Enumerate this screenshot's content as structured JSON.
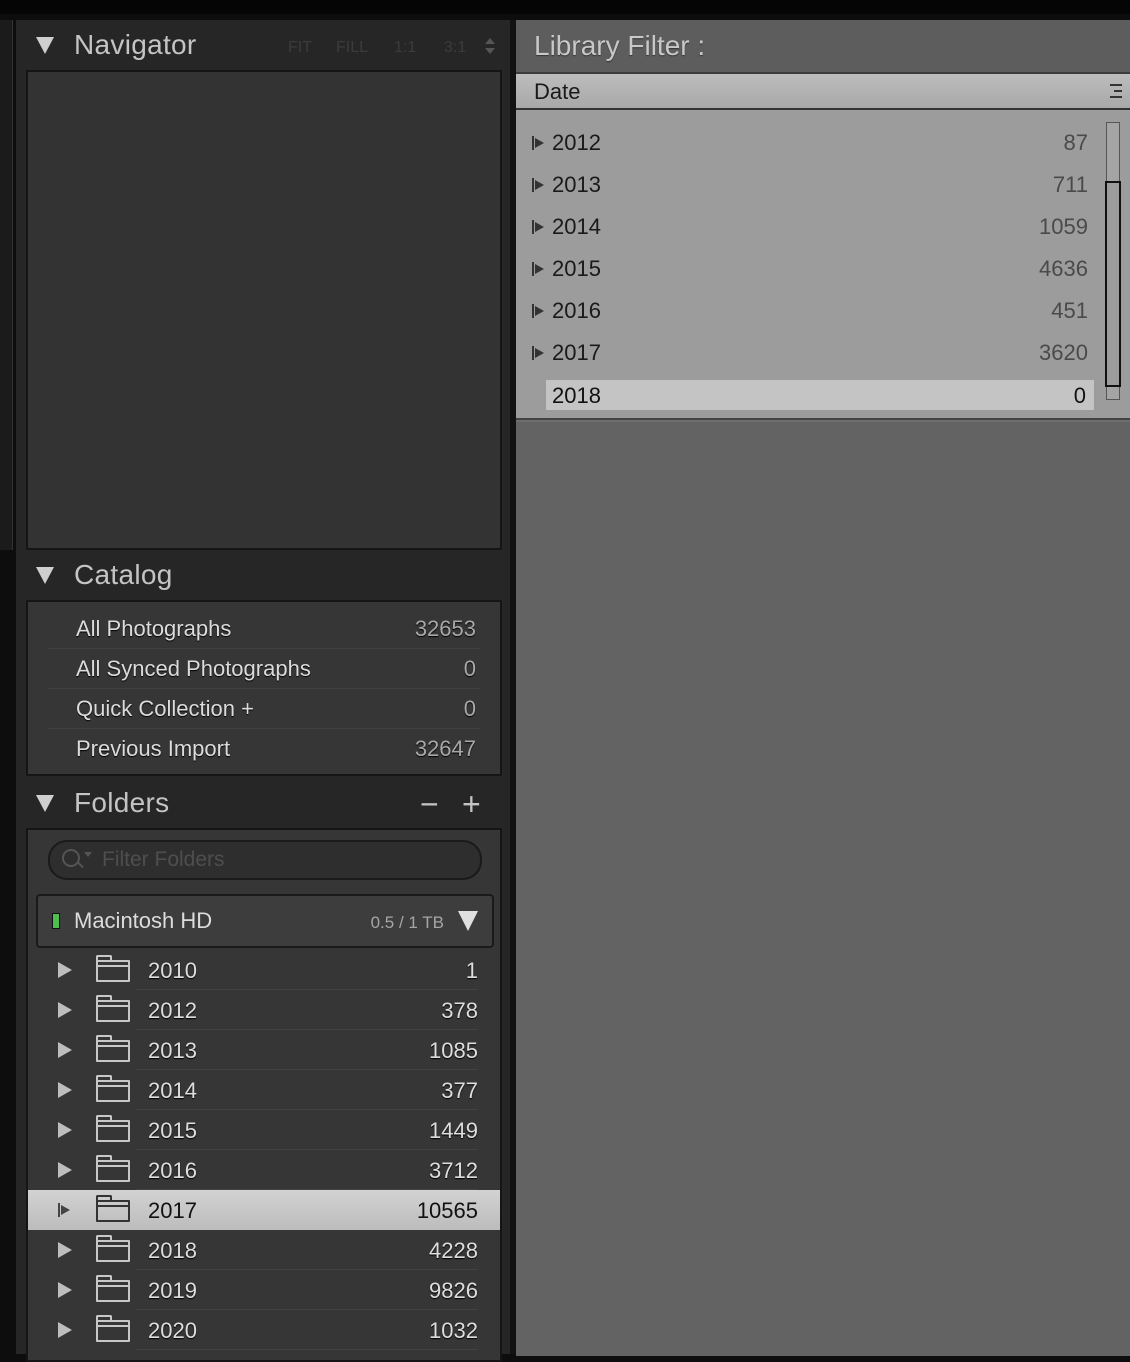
{
  "navigator": {
    "title": "Navigator",
    "zoom_options": [
      "FIT",
      "FILL",
      "1:1",
      "3:1"
    ]
  },
  "catalog": {
    "title": "Catalog",
    "items": [
      {
        "label": "All Photographs",
        "count": "32653"
      },
      {
        "label": "All Synced Photographs",
        "count": "0"
      },
      {
        "label": "Quick Collection  +",
        "count": "0"
      },
      {
        "label": "Previous Import",
        "count": "32647"
      }
    ]
  },
  "folders": {
    "title": "Folders",
    "minus_label": "−",
    "plus_label": "+",
    "filter_placeholder": "Filter Folders",
    "volume": {
      "name": "Macintosh HD",
      "size": "0.5 / 1 TB",
      "status_color": "#4cbf4c"
    },
    "items": [
      {
        "name": "2010",
        "count": "1"
      },
      {
        "name": "2012",
        "count": "378"
      },
      {
        "name": "2013",
        "count": "1085"
      },
      {
        "name": "2014",
        "count": "377"
      },
      {
        "name": "2015",
        "count": "1449"
      },
      {
        "name": "2016",
        "count": "3712"
      },
      {
        "name": "2017",
        "count": "10565",
        "selected": true
      },
      {
        "name": "2018",
        "count": "4228"
      },
      {
        "name": "2019",
        "count": "9826"
      },
      {
        "name": "2020",
        "count": "1032"
      }
    ]
  },
  "library_filter": {
    "title": "Library Filter :",
    "column": "Date",
    "dates": [
      {
        "year": "2012",
        "count": "87"
      },
      {
        "year": "2013",
        "count": "711"
      },
      {
        "year": "2014",
        "count": "1059"
      },
      {
        "year": "2015",
        "count": "4636"
      },
      {
        "year": "2016",
        "count": "451"
      },
      {
        "year": "2017",
        "count": "3620"
      },
      {
        "year": "2018",
        "count": "0",
        "selected": true
      }
    ]
  },
  "icons": {
    "disclosure": "triangle-down-icon",
    "expand": "triangle-right-icon",
    "folder": "folder-icon",
    "search": "search-icon",
    "menu": "column-menu-icon"
  }
}
